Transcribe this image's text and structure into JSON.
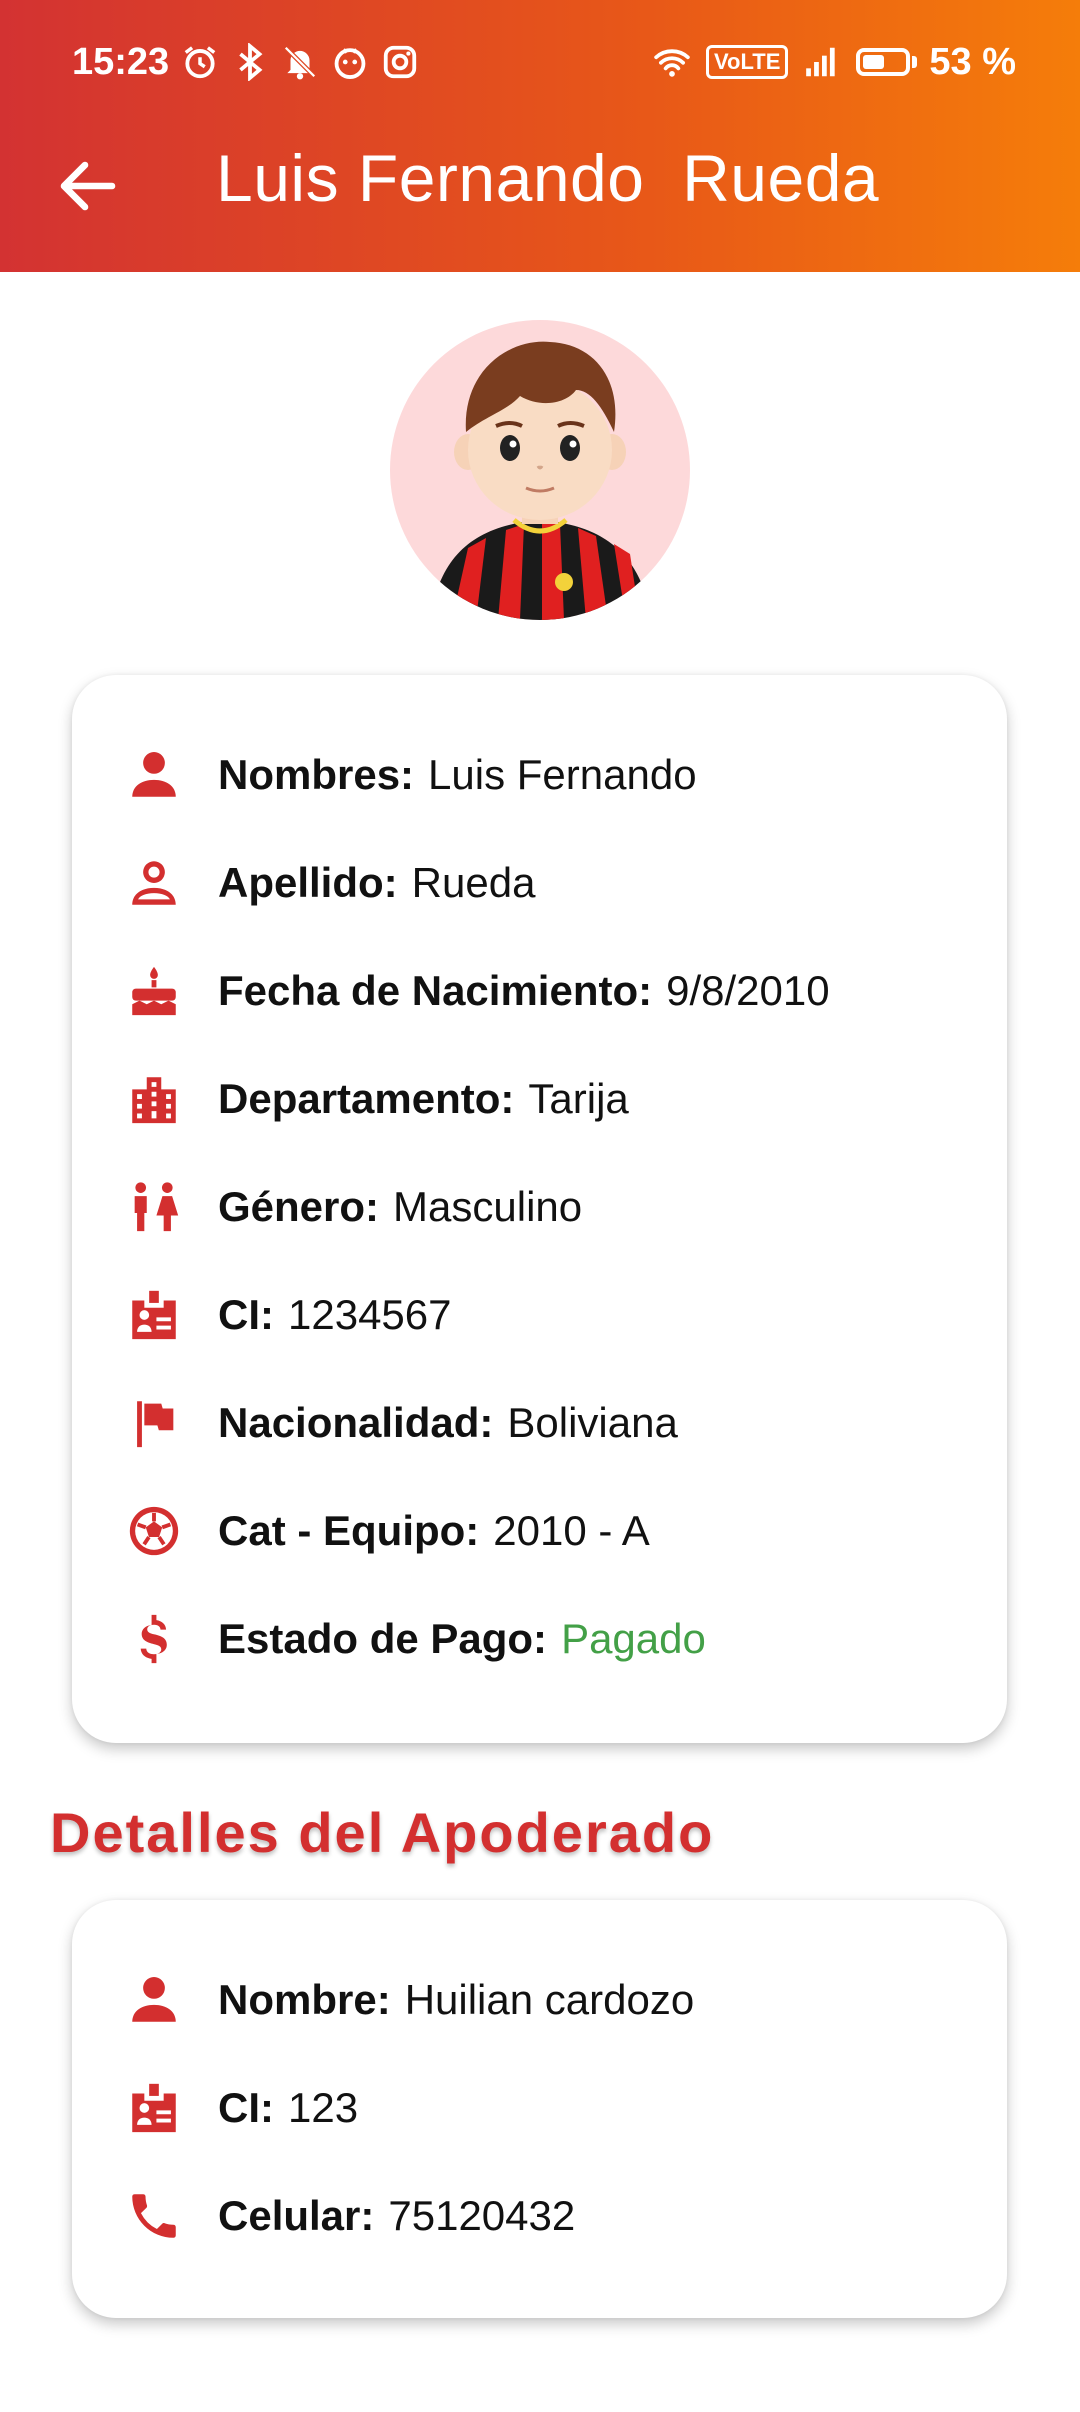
{
  "status_bar": {
    "time": "15:23",
    "volte": "VoLTE",
    "battery_percent": "53 %",
    "battery_level": 0.53
  },
  "header": {
    "title": "Luis Fernando  Rueda",
    "back_icon": "arrow-left-icon"
  },
  "colors": {
    "accent": "#d32f2f",
    "header_gradient_start": "#d33232",
    "header_gradient_end": "#f57d0a",
    "paid": "#43a047"
  },
  "player": {
    "rows": [
      {
        "icon": "person-icon",
        "label": "Nombres:",
        "value": "Luis Fernando"
      },
      {
        "icon": "person-outline-icon",
        "label": "Apellido:",
        "value": "Rueda"
      },
      {
        "icon": "cake-icon",
        "label": "Fecha de Nacimiento:",
        "value": "9/8/2010"
      },
      {
        "icon": "city-icon",
        "label": "Departamento:",
        "value": "Tarija"
      },
      {
        "icon": "wc-icon",
        "label": "Género:",
        "value": "Masculino"
      },
      {
        "icon": "badge-icon",
        "label": "CI:",
        "value": "1234567"
      },
      {
        "icon": "flag-icon",
        "label": "Nacionalidad:",
        "value": "Boliviana"
      },
      {
        "icon": "soccer-ball-icon",
        "label": "Cat - Equipo:",
        "value": "2010 - A"
      },
      {
        "icon": "dollar-icon",
        "label": "Estado de Pago:",
        "value": "Pagado"
      }
    ]
  },
  "guardian": {
    "section_title": "Detalles del Apoderado",
    "rows": [
      {
        "icon": "person-icon",
        "label": "Nombre:",
        "value": "Huilian cardozo"
      },
      {
        "icon": "badge-icon",
        "label": "CI:",
        "value": "123"
      },
      {
        "icon": "phone-icon",
        "label": "Celular:",
        "value": "75120432"
      }
    ]
  }
}
